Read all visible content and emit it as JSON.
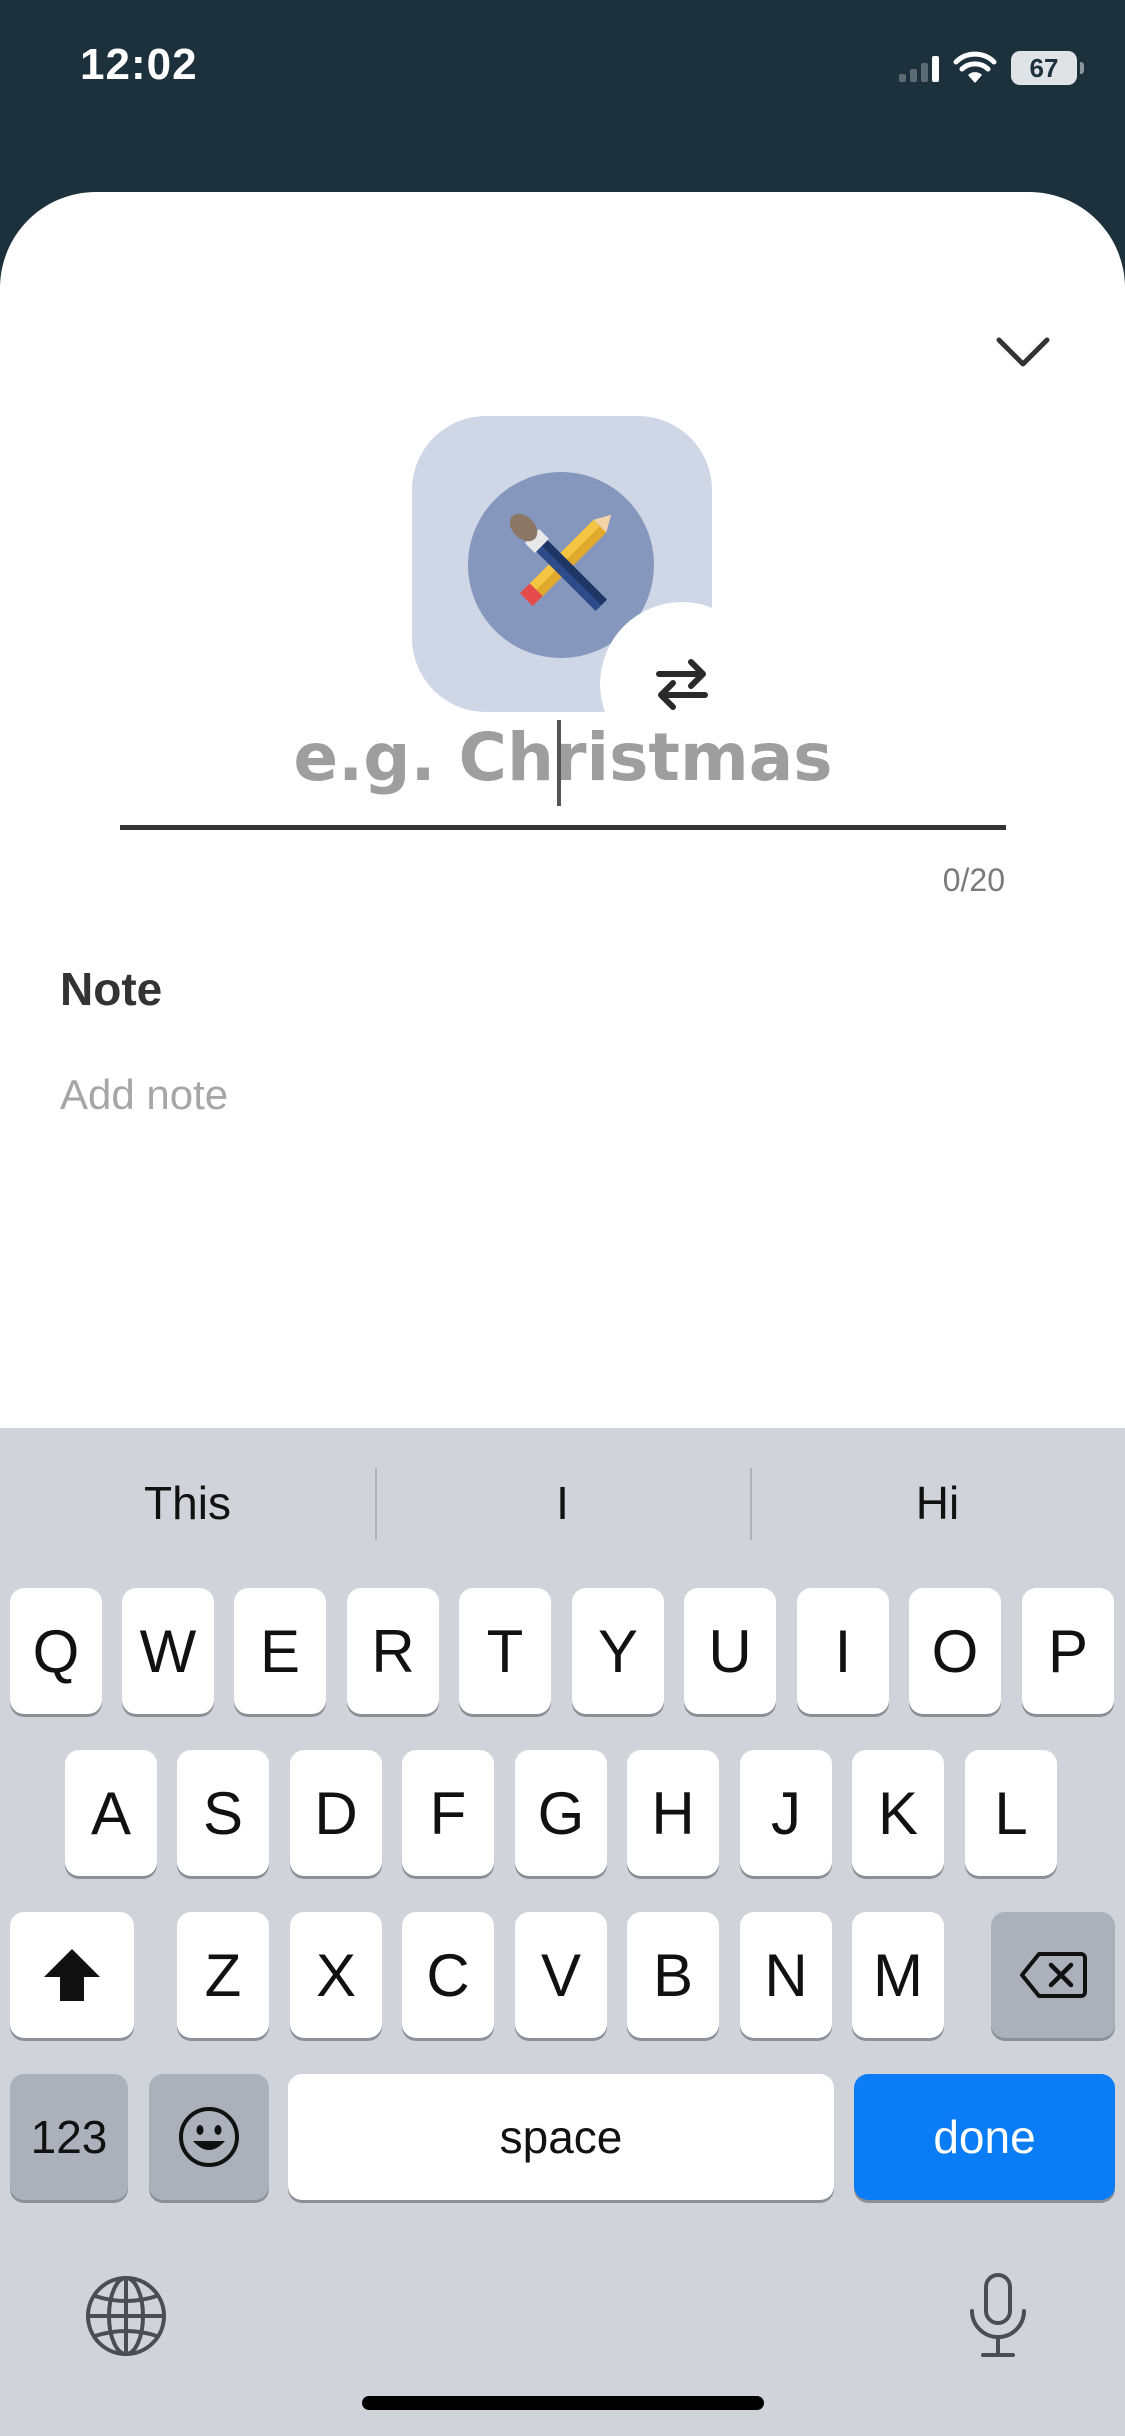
{
  "status_bar": {
    "time": "12:02",
    "battery": "67"
  },
  "form": {
    "name_placeholder": "e.g. Christmas",
    "counter": "0/20",
    "note_label": "Note",
    "note_placeholder": "Add note"
  },
  "icons": {
    "collapse": "chevron-down-icon",
    "category": "paint-tools-icon",
    "swap": "swap-arrows-icon"
  },
  "keyboard": {
    "suggestions": [
      "This",
      "I",
      "Hi"
    ],
    "row1": [
      "Q",
      "W",
      "E",
      "R",
      "T",
      "Y",
      "U",
      "I",
      "O",
      "P"
    ],
    "row2": [
      "A",
      "S",
      "D",
      "F",
      "G",
      "H",
      "J",
      "K",
      "L"
    ],
    "row3": [
      "Z",
      "X",
      "C",
      "V",
      "B",
      "N",
      "M"
    ],
    "numbers_label": "123",
    "space_label": "space",
    "done_label": "done"
  },
  "colors": {
    "header_bg": "#1d313c",
    "tile_bg": "#cfd6e6",
    "circle_bg": "#8597bc",
    "done_key": "#0a7cf5"
  }
}
